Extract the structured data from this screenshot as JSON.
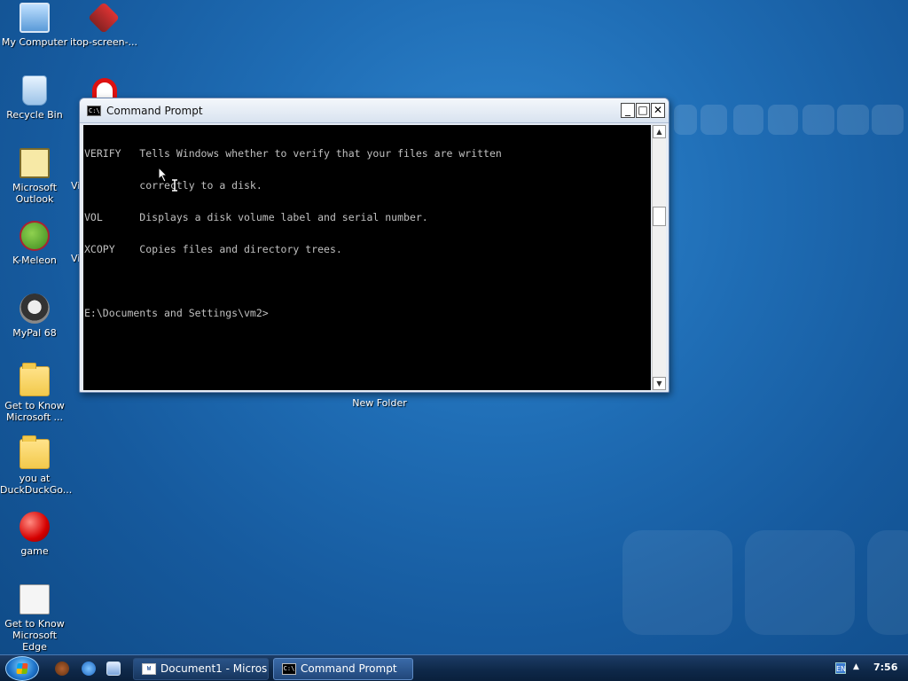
{
  "desktop": {
    "icons": [
      {
        "label": "My Computer",
        "icon": "monitor-icon"
      },
      {
        "label": "itop-screen-...",
        "icon": "itop-icon"
      },
      {
        "label": "Recycle Bin",
        "icon": "recycle-bin-icon"
      },
      {
        "label": "Microsoft Outlook",
        "icon": "outlook-icon"
      },
      {
        "label": "K-Meleon",
        "icon": "k-meleon-icon"
      },
      {
        "label": "MyPal 68",
        "icon": "raccoon-icon"
      },
      {
        "label": "Get to Know Microsoft ...",
        "icon": "folder-icon"
      },
      {
        "label": "you at DuckDuckGo...",
        "icon": "folder-icon"
      },
      {
        "label": "game",
        "icon": "red-ball-icon"
      },
      {
        "label": "Get to Know Microsoft Edge",
        "icon": "document-icon"
      }
    ],
    "partial_labels": [
      "Vi",
      "Vi"
    ],
    "new_folder_label": "New Folder"
  },
  "window": {
    "title": "Command Prompt",
    "icon_text": "C:\\",
    "buttons": {
      "minimize": "_",
      "maximize": "□",
      "close": "✕"
    },
    "console_lines": [
      "VERIFY   Tells Windows whether to verify that your files are written",
      "         correctly to a disk.",
      "VOL      Displays a disk volume label and serial number.",
      "XCOPY    Copies files and directory trees.",
      "",
      "E:\\Documents and Settings\\vm2>"
    ],
    "scroll_up": "▲",
    "scroll_down": "▼"
  },
  "taskbar": {
    "tasks": [
      {
        "label": "Document1 - Micros...",
        "icon_text": "W"
      },
      {
        "label": "Command Prompt",
        "icon_text": "C:\\"
      }
    ],
    "language": "EN",
    "tray_arrow": "▲",
    "clock": "7:56"
  },
  "colors": {
    "desktop": "#1f6db5",
    "console_bg": "#000000",
    "console_text": "#c0c0c0",
    "taskbar": "#0e2848"
  }
}
